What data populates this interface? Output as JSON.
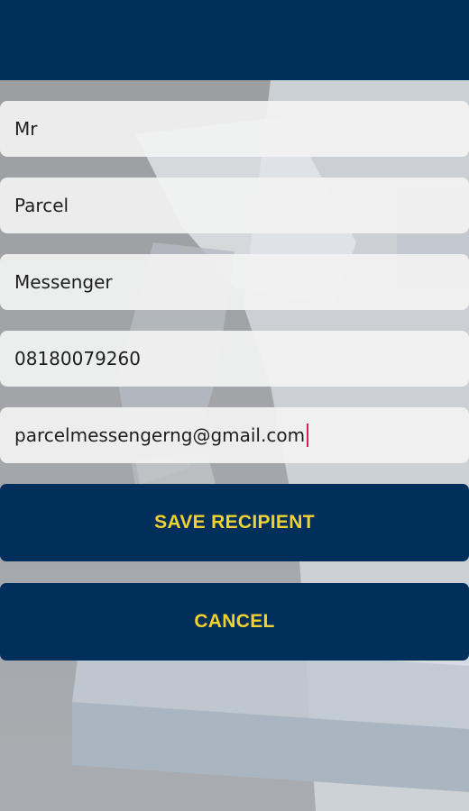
{
  "colors": {
    "header": "#002f5c",
    "button": "#002f5c",
    "button_text": "#f2d22f",
    "field_bg": "#f2f2f2",
    "caret": "#d81b60"
  },
  "form": {
    "fields": [
      {
        "value": "Mr"
      },
      {
        "value": "Parcel"
      },
      {
        "value": "Messenger"
      },
      {
        "value": "08180079260"
      },
      {
        "value": "parcelmessengerng@gmail.com",
        "focused": true
      }
    ]
  },
  "buttons": {
    "save_label": "SAVE RECIPIENT",
    "cancel_label": "CANCEL"
  }
}
